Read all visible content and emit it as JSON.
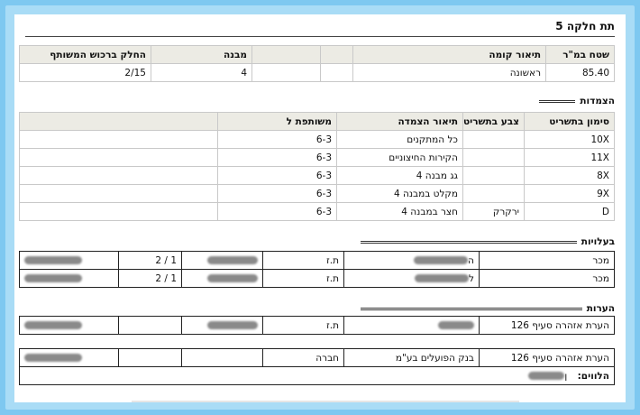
{
  "subpart": {
    "title": "תת חלקה 5"
  },
  "unit": {
    "headers": [
      "שטח במ\"ר",
      "תיאור קומה",
      "",
      "",
      "מבנה",
      "החלק ברכוש המשותף"
    ],
    "row": [
      "85.40",
      "ראשונה",
      "",
      "",
      "4",
      "2/15"
    ]
  },
  "attachments": {
    "heading": "הצמדות",
    "headers": [
      "סימון בתשריט",
      "צבע בתשריט",
      "תיאור הצמדה",
      "משותפת ל",
      ""
    ],
    "rows": [
      [
        "10X",
        "",
        "כל המתקנים",
        "6-3",
        ""
      ],
      [
        "11X",
        "",
        "הקירות החיצוניים",
        "6-3",
        ""
      ],
      [
        "8X",
        "",
        "גג מבנה 4",
        "6-3",
        ""
      ],
      [
        "9X",
        "",
        "מקלט במבנה 4",
        "6-3",
        ""
      ],
      [
        "D",
        "ירקרק",
        "חצר במבנה 4",
        "6-3",
        ""
      ]
    ]
  },
  "owners": {
    "heading": "בעלויות",
    "rows": [
      [
        "מכר",
        "ה",
        "ת.ז",
        "",
        "1 / 2",
        ""
      ],
      [
        "מכר",
        "ל",
        "ת.ז",
        "",
        "1 / 2",
        ""
      ]
    ]
  },
  "notes": {
    "heading": "הערות",
    "row1": [
      "הערת אזהרה סעיף 126",
      "",
      "ת.ז",
      "",
      "",
      ""
    ],
    "row2": [
      "הערת אזהרה סעיף 126",
      "בנק הפועלים בע\"מ",
      "חברה",
      "",
      "",
      ""
    ],
    "borrowers_label": "הלווים:",
    "borrower_value": "ן"
  }
}
